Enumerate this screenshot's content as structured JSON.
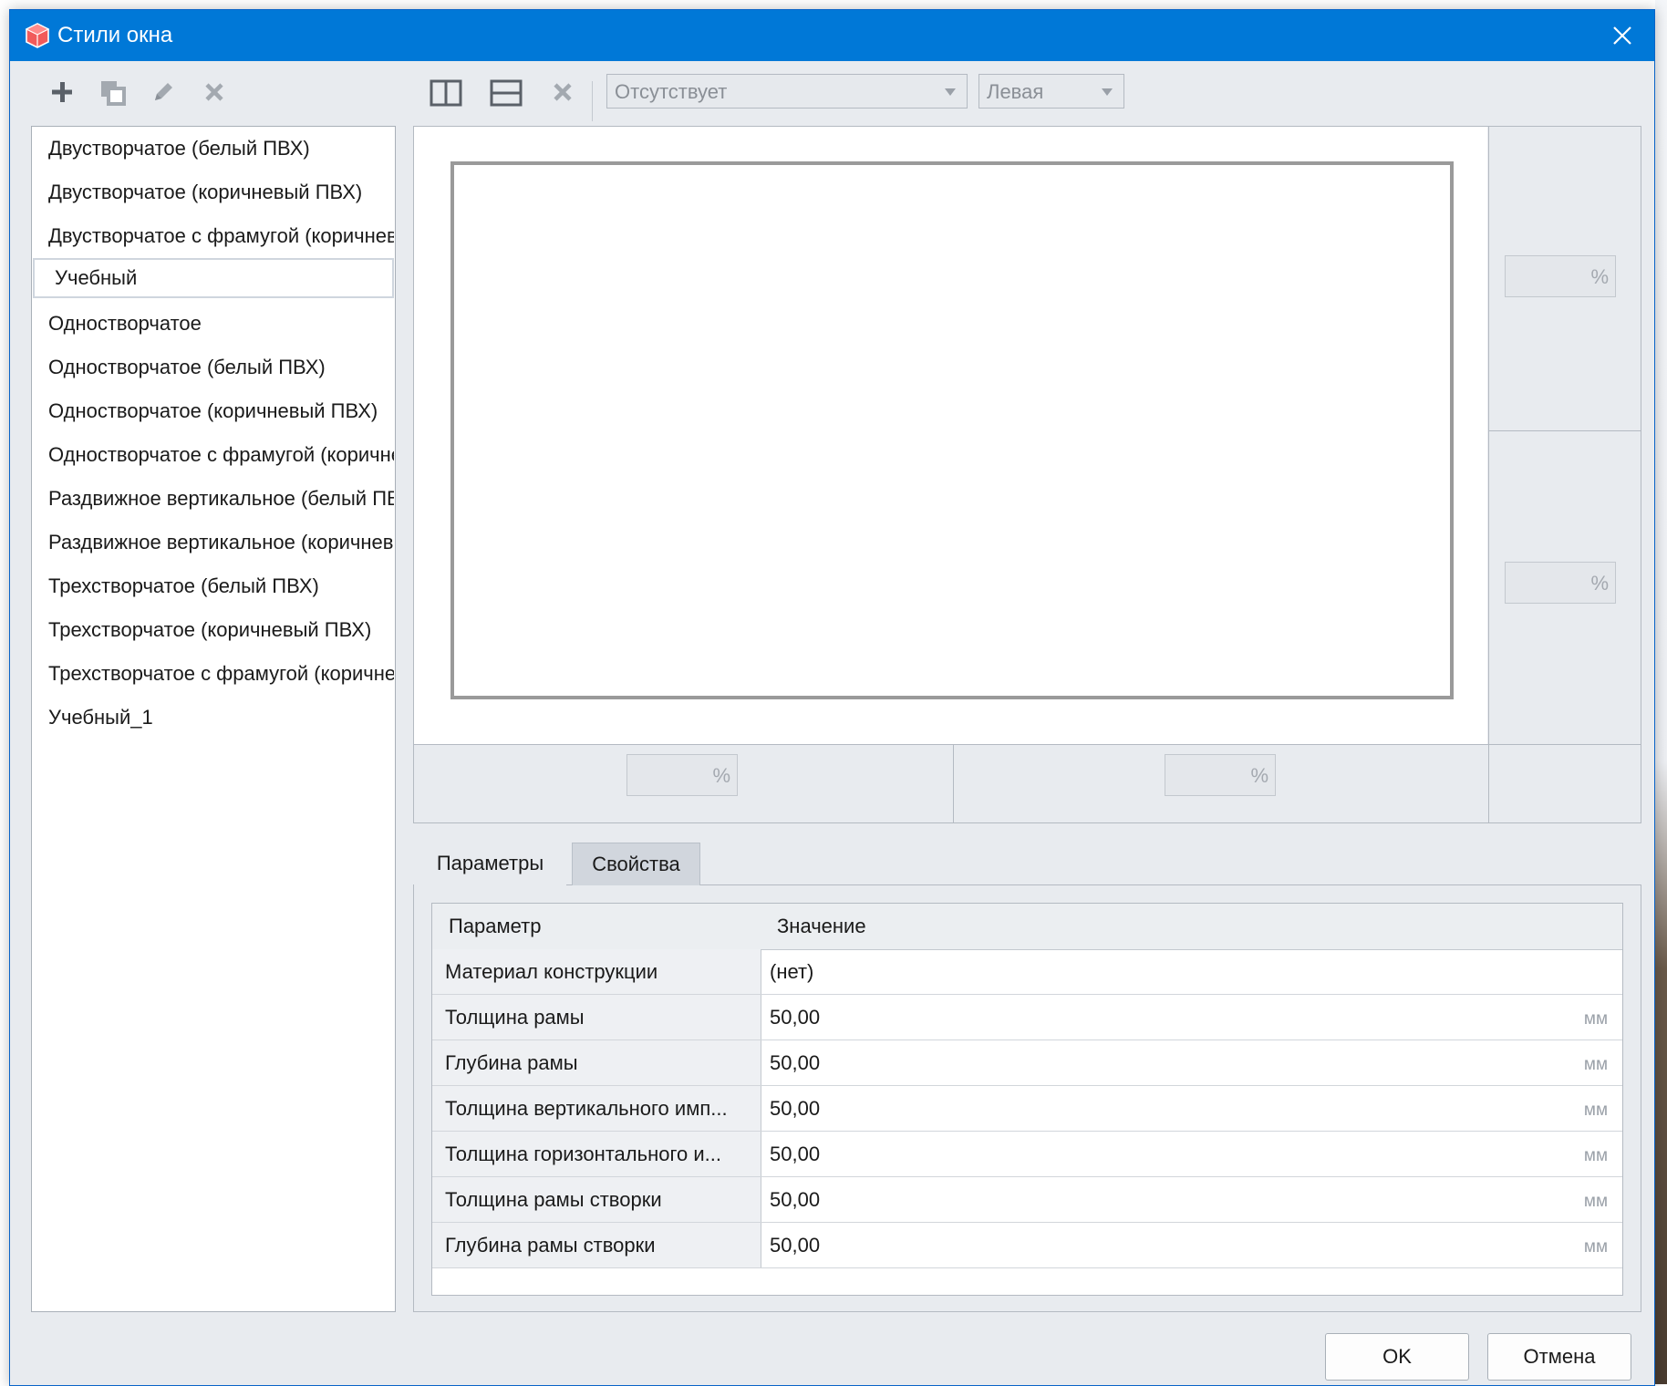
{
  "window": {
    "title": "Стили окна",
    "icon": "cube-icon"
  },
  "toolbar": {
    "left_icons": [
      "plus-icon",
      "duplicate-icon",
      "pencil-icon",
      "delete-icon"
    ],
    "right_icons": [
      "split-vertical-icon",
      "split-horizontal-icon",
      "delete-icon"
    ],
    "opening_type": "Отсутствует",
    "hinge_side": "Левая"
  },
  "styles": [
    "Двустворчатое (белый ПВХ)",
    "Двустворчатое (коричневый ПВХ)",
    "Двустворчатое с фрамугой (коричневый ПВХ)",
    "Учебный",
    "Одностворчатое",
    "Одностворчатое (белый ПВХ)",
    "Одностворчатое (коричневый ПВХ)",
    "Одностворчатое с фрамугой (коричневый ПВХ)",
    "Раздвижное вертикальное (белый ПВХ)",
    "Раздвижное вертикальное (коричневый ПВХ)",
    "Трехстворчатое (белый ПВХ)",
    "Трехстворчатое (коричневый ПВХ)",
    "Трехстворчатое с фрамугой (коричневый ПВХ)",
    "Учебный_1"
  ],
  "selected_style_index": 3,
  "percent_fields": {
    "unit": "%"
  },
  "tabs": {
    "params": "Параметры",
    "properties": "Свойства"
  },
  "grid": {
    "col_param": "Параметр",
    "col_value": "Значение",
    "rows": [
      {
        "name": "Материал конструкции",
        "value": "(нет)",
        "unit": ""
      },
      {
        "name": "Толщина рамы",
        "value": "50,00",
        "unit": "мм"
      },
      {
        "name": "Глубина рамы",
        "value": "50,00",
        "unit": "мм"
      },
      {
        "name": "Толщина вертикального имп...",
        "value": "50,00",
        "unit": "мм"
      },
      {
        "name": "Толщина горизонтального и...",
        "value": "50,00",
        "unit": "мм"
      },
      {
        "name": "Толщина рамы створки",
        "value": "50,00",
        "unit": "мм"
      },
      {
        "name": "Глубина рамы створки",
        "value": "50,00",
        "unit": "мм"
      }
    ]
  },
  "buttons": {
    "ok": "OK",
    "cancel": "Отмена"
  },
  "colors": {
    "titlebar": "#0078d7",
    "dialog_bg": "#e8ebef"
  }
}
